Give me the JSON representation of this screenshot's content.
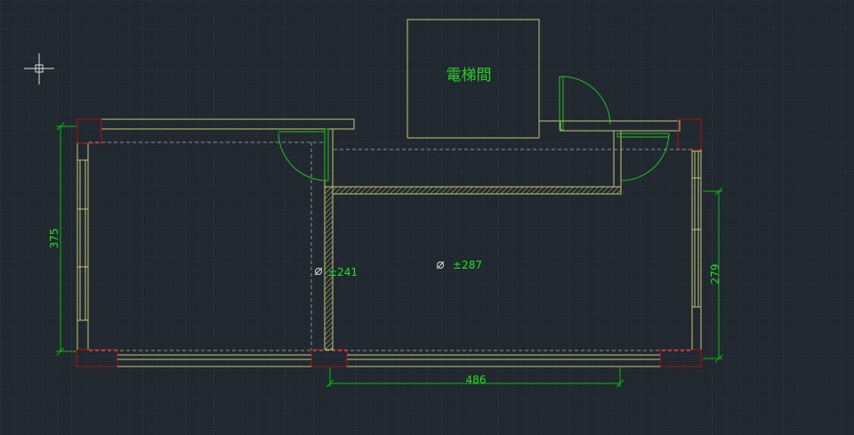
{
  "drawing": {
    "room_label": "電梯間",
    "dimensions": {
      "left_height": "375",
      "right_height": "279",
      "bottom_width": "486"
    },
    "elevations": {
      "left": "±241",
      "right": "±287"
    }
  },
  "colors": {
    "background": "#212830",
    "grid_minor": "#262e37",
    "grid_major": "#2d3640",
    "wall": "#c8c870",
    "column": "#b01010",
    "door": "#22c022",
    "dimension": "#00c000",
    "dimension_text": "#19e619",
    "hidden_line": "#8a8f96",
    "cursor": "#dddddd"
  }
}
